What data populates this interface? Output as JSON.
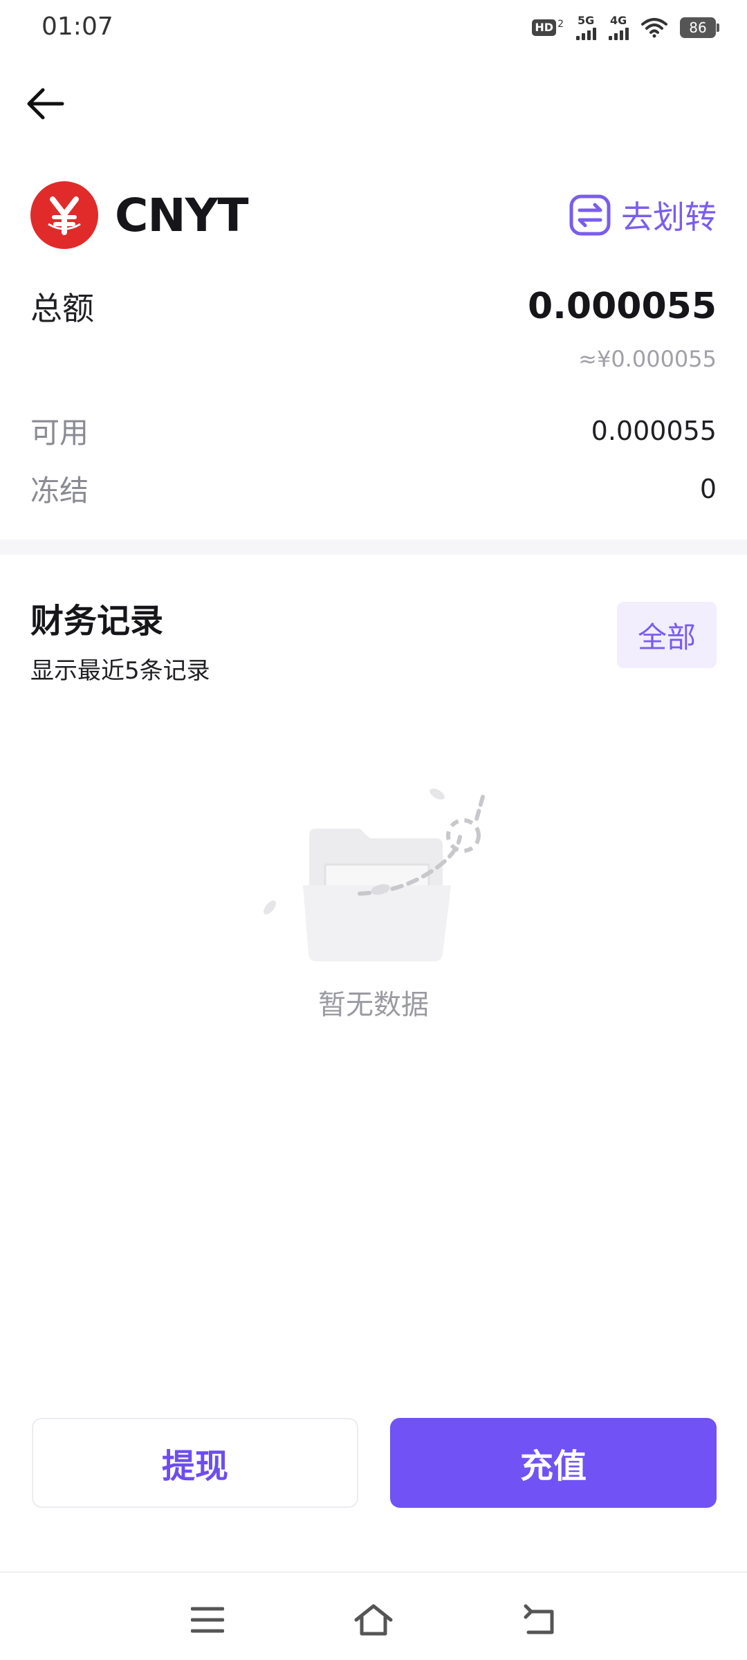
{
  "status_bar": {
    "time": "01:07",
    "hd_label": "HD",
    "hd_sub": "2",
    "net1": "5G",
    "net2": "4G",
    "battery": "86"
  },
  "header": {
    "back_icon": "arrow-left-icon"
  },
  "coin": {
    "symbol": "CNYT",
    "logo_icon": "yuan-coin-icon",
    "logo_color": "#e12b2b",
    "transfer_label": "去划转",
    "transfer_icon": "transfer-icon"
  },
  "balance": {
    "total_label": "总额",
    "total_value": "0.000055",
    "total_cny": "≈¥0.000055",
    "available_label": "可用",
    "available_value": "0.000055",
    "frozen_label": "冻结",
    "frozen_value": "0"
  },
  "records": {
    "title": "财务记录",
    "subtitle": "显示最近5条记录",
    "all_label": "全部",
    "empty_text": "暂无数据",
    "empty_icon": "empty-folder-icon"
  },
  "actions": {
    "withdraw_label": "提现",
    "deposit_label": "充值"
  },
  "nav": {
    "menu_icon": "menu-icon",
    "home_icon": "home-icon",
    "back_icon": "back-icon"
  },
  "colors": {
    "accent": "#7152f5",
    "accent_light": "#f2eefd",
    "coin_red": "#e12b2b"
  }
}
